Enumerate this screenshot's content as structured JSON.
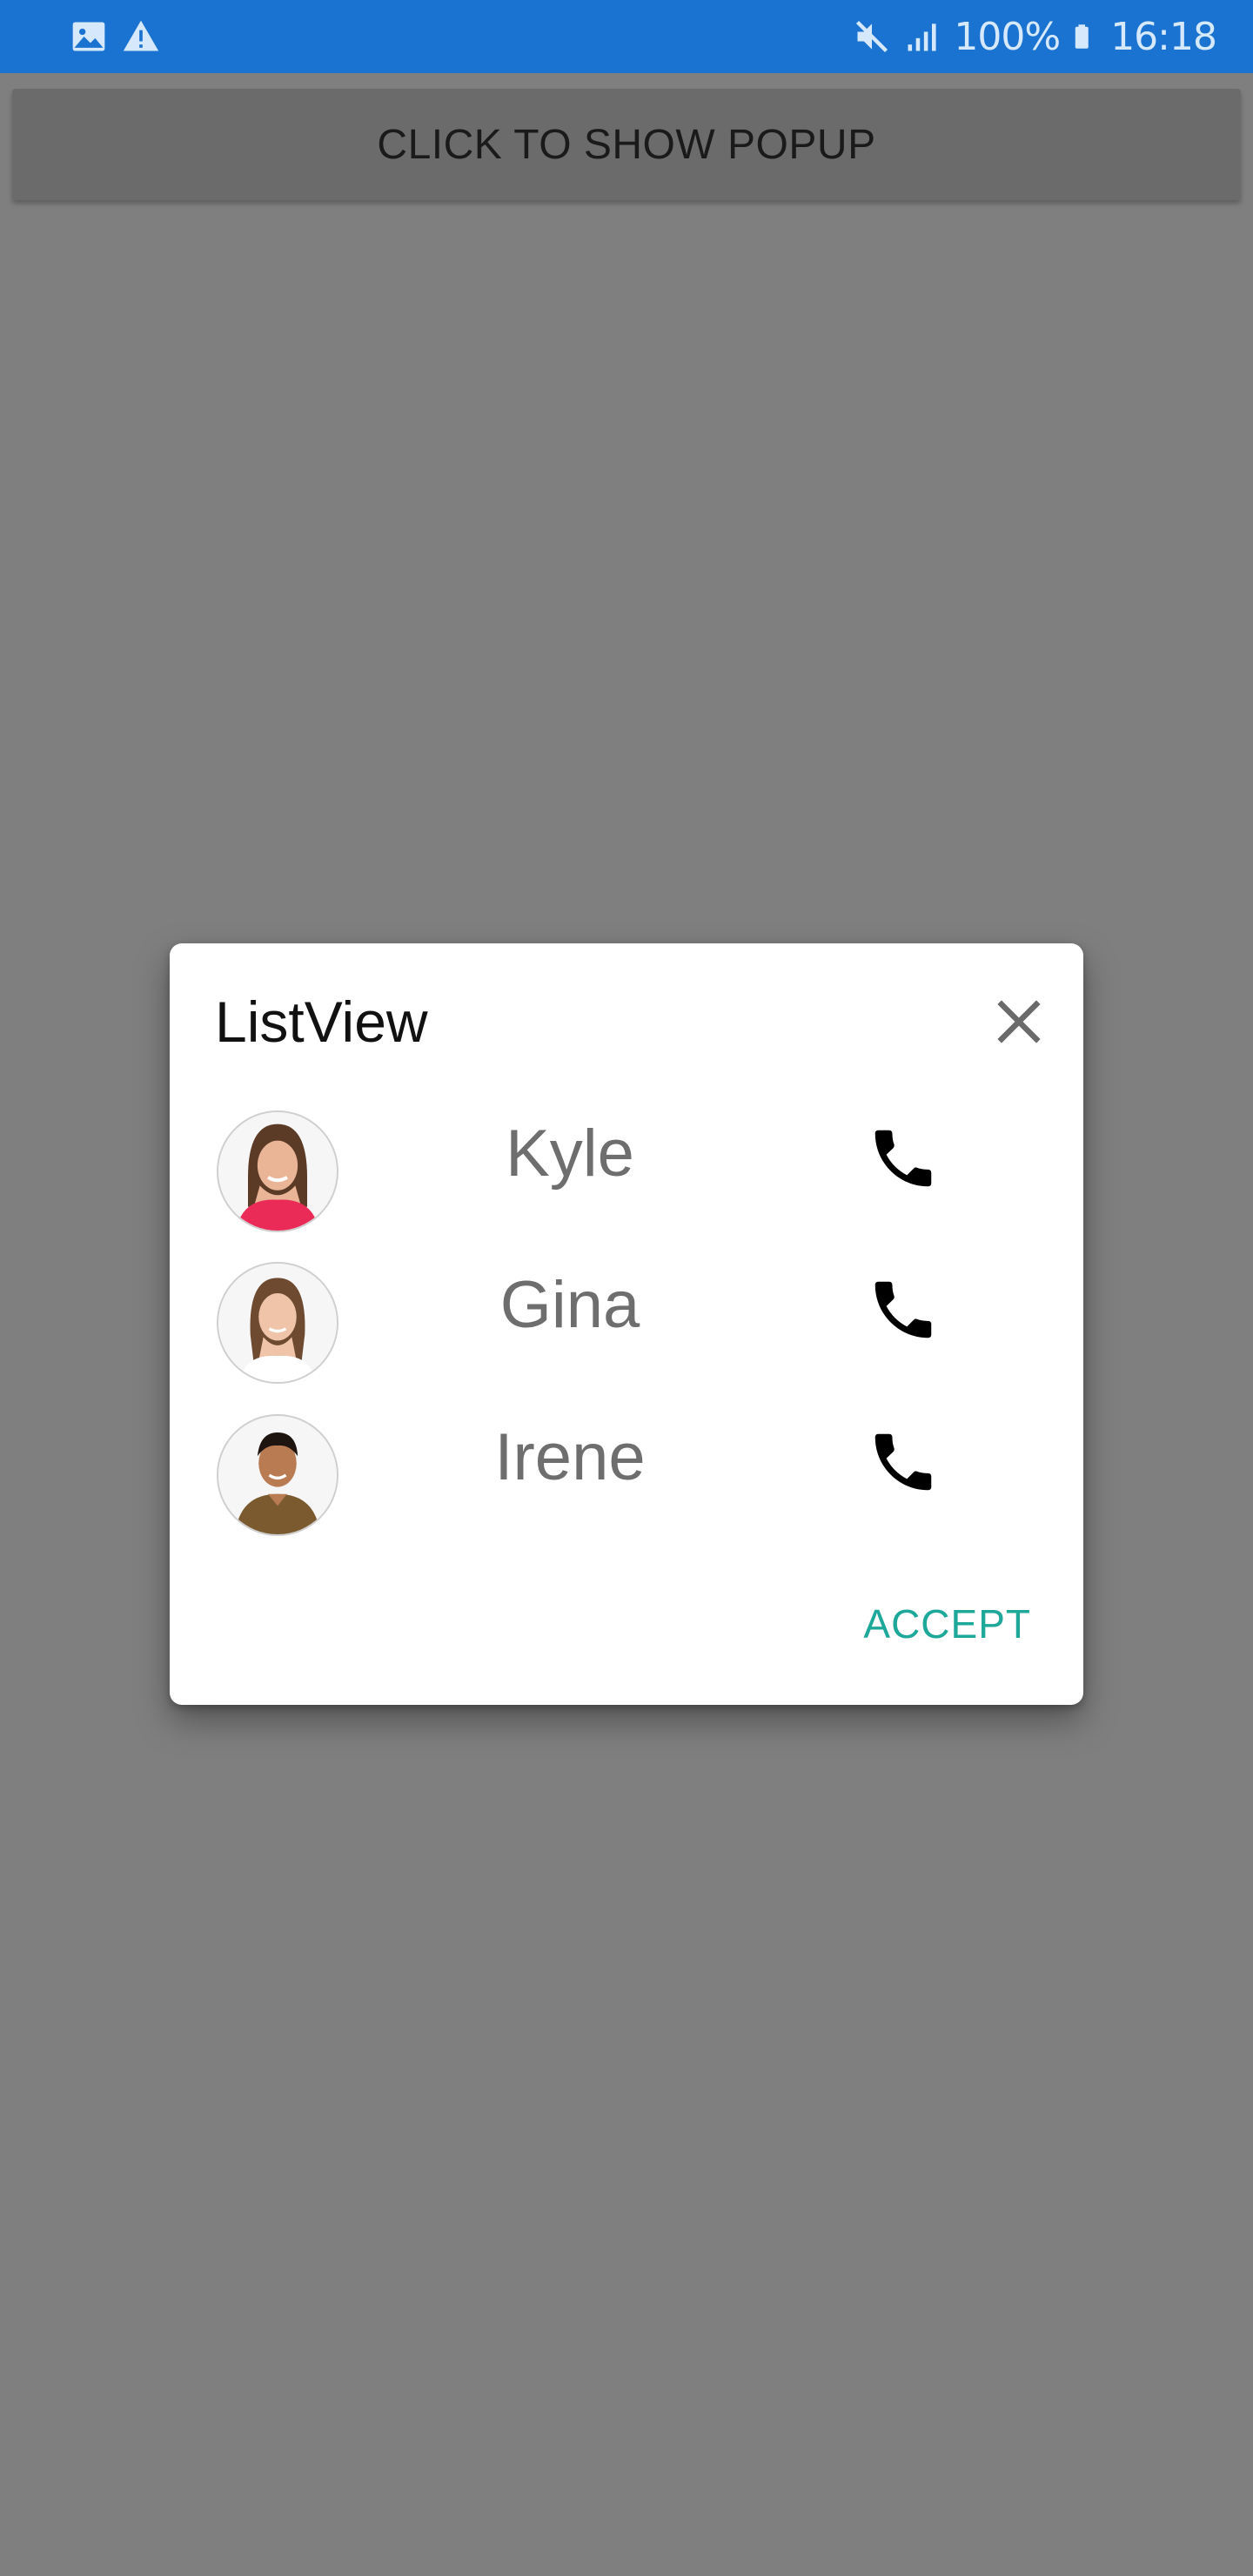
{
  "status_bar": {
    "left_icons": [
      "image-icon",
      "warning-icon"
    ],
    "right_icons": [
      "mute-icon",
      "signal-icon",
      "battery-icon"
    ],
    "battery": "100%",
    "time": "16:18",
    "colors": {
      "background": "#1a73d1",
      "foreground": "#d6e8fc"
    }
  },
  "main": {
    "show_popup_label": "CLICK TO SHOW POPUP"
  },
  "dialog": {
    "title": "ListView",
    "close_icon": "close-icon",
    "contacts": [
      {
        "name": "Kyle",
        "avatar": "avatar-photo",
        "call_icon": "phone-icon"
      },
      {
        "name": "Gina",
        "avatar": "avatar-photo",
        "call_icon": "phone-icon"
      },
      {
        "name": "Irene",
        "avatar": "avatar-photo",
        "call_icon": "phone-icon"
      }
    ],
    "accept_label": "ACCEPT",
    "colors": {
      "accent": "#1ea89a",
      "name_text": "#6e6e6e"
    }
  },
  "colors": {
    "overlay": "#7f7f7f"
  }
}
